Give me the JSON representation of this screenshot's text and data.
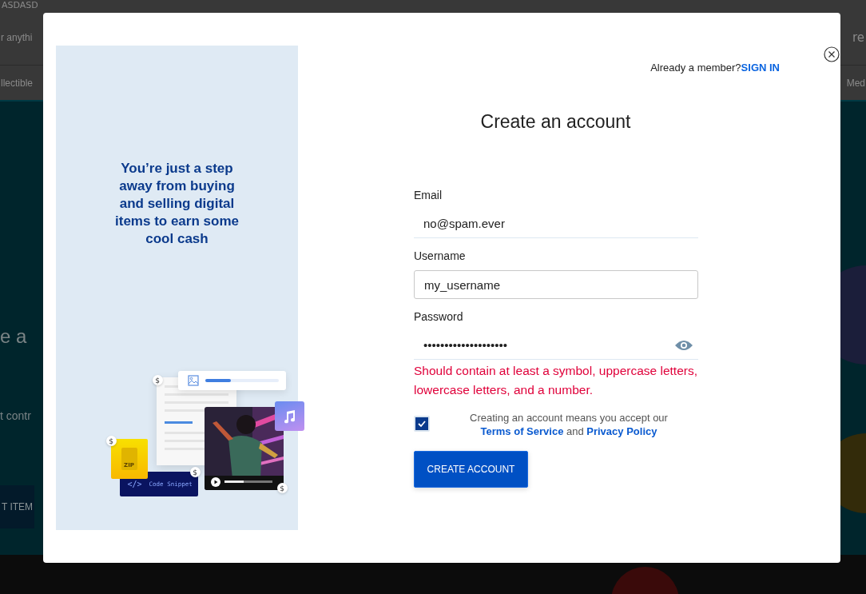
{
  "background": {
    "header_title": "ASDASD",
    "search_placeholder": "r anythi",
    "header_link": "re",
    "categories": [
      "llectible",
      "Med"
    ],
    "hero_heading": "e a",
    "hero_text": "t contr",
    "hero_button": "T ITEM"
  },
  "modal": {
    "promo": {
      "text": "You’re just a step away from buying and selling digital items to earn some cool cash",
      "illustration": {
        "code_icon": "</>",
        "code_label": "Code Snippet",
        "zip_label": "ZIP",
        "price_tags": [
          "$",
          "$",
          "$",
          "$"
        ]
      }
    },
    "sign_in_prompt": {
      "text": "Already a member?",
      "link": "SIGN IN"
    },
    "title": "Create an account",
    "fields": [
      {
        "label": "Email",
        "kind": "underline",
        "value": "no@spam.ever"
      },
      {
        "label": "Username",
        "kind": "outlined",
        "value": "my_username"
      },
      {
        "label": "Password",
        "kind": "underline",
        "value": "••••••••••••••••••••",
        "reveal_toggle": true,
        "error": "Should contain at least a symbol, uppercase letters, lowercase letters, and a number."
      }
    ],
    "terms": {
      "checked": true,
      "text": "Creating an account means you accept our ",
      "terms_link": "Terms of Service",
      "joiner": " and ",
      "privacy_link": "Privacy Policy"
    },
    "submit": "CREATE ACCOUNT"
  }
}
